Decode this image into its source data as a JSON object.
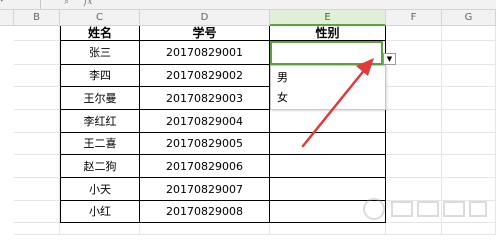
{
  "toolbar": {
    "zoom_icon": "zoom-icon",
    "fx_label": "fx"
  },
  "columns": [
    "B",
    "C",
    "D",
    "E",
    "F",
    "G"
  ],
  "table": {
    "headers": {
      "name": "姓名",
      "id": "学号",
      "gender": "性别"
    },
    "rows": [
      {
        "name": "张三",
        "id": "20170829001"
      },
      {
        "name": "李四",
        "id": "20170829002"
      },
      {
        "name": "王尔曼",
        "id": "20170829003"
      },
      {
        "name": "李红红",
        "id": "20170829004"
      },
      {
        "name": "王二喜",
        "id": "20170829005"
      },
      {
        "name": "赵二狗",
        "id": "20170829006"
      },
      {
        "name": "小天",
        "id": "20170829007"
      },
      {
        "name": "小红",
        "id": "20170829008"
      }
    ]
  },
  "dropdown": {
    "options": [
      "男",
      "女"
    ]
  },
  "colors": {
    "selection": "#5ea13e",
    "arrow": "#e03a3a",
    "header_bg": "#f2f2f2"
  }
}
